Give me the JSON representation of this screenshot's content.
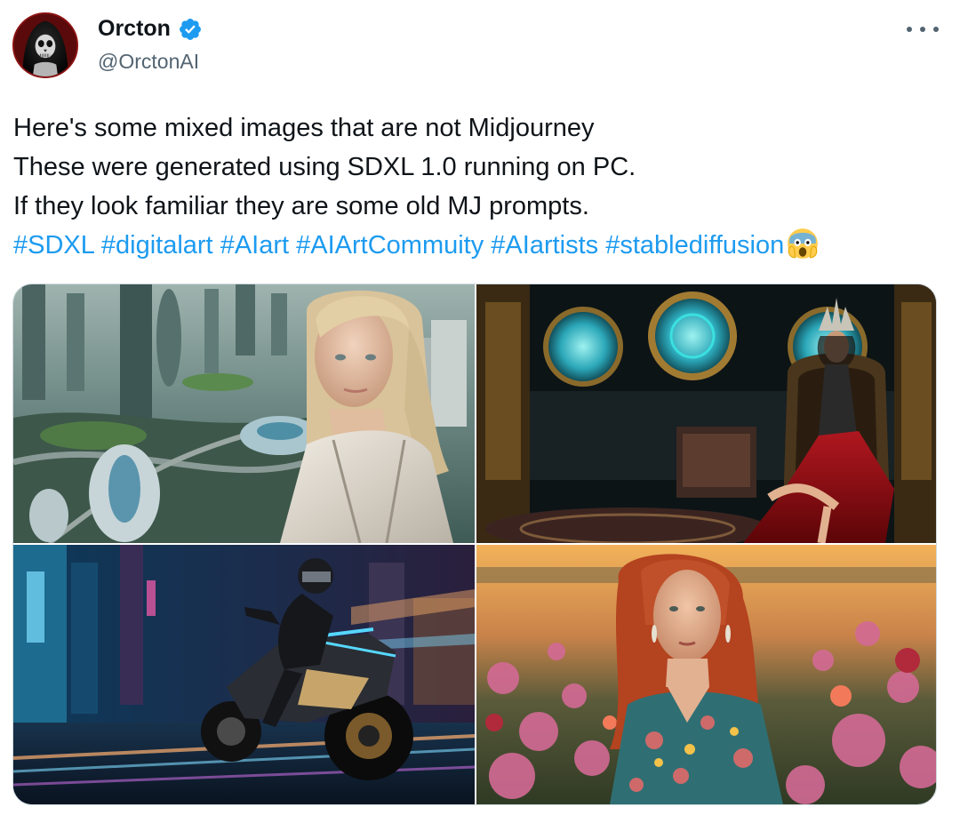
{
  "author": {
    "display_name": "Orcton",
    "handle": "@OrctonAI",
    "verified": true,
    "verified_color": "#1d9bf0",
    "avatar_icon": "hooded-skull-avatar"
  },
  "menu": {
    "icon": "more-options-icon"
  },
  "tweet": {
    "lines": [
      "Here's some mixed images that are not Midjourney",
      "These were generated using SDXL 1.0 running on PC.",
      "If they look familiar they are some old MJ prompts."
    ],
    "hashtags": [
      "#SDXL",
      "#digitalart",
      "#AIart",
      "#AIArtCommuity",
      "#AIartists",
      "#stablediffusion"
    ],
    "emoji": "screaming-face-emoji",
    "link_color": "#1d9bf0"
  },
  "media": [
    {
      "name": "futuristic-city-woman-image"
    },
    {
      "name": "throne-queen-image"
    },
    {
      "name": "cyber-motorcycle-image"
    },
    {
      "name": "redhead-flower-field-image"
    }
  ]
}
